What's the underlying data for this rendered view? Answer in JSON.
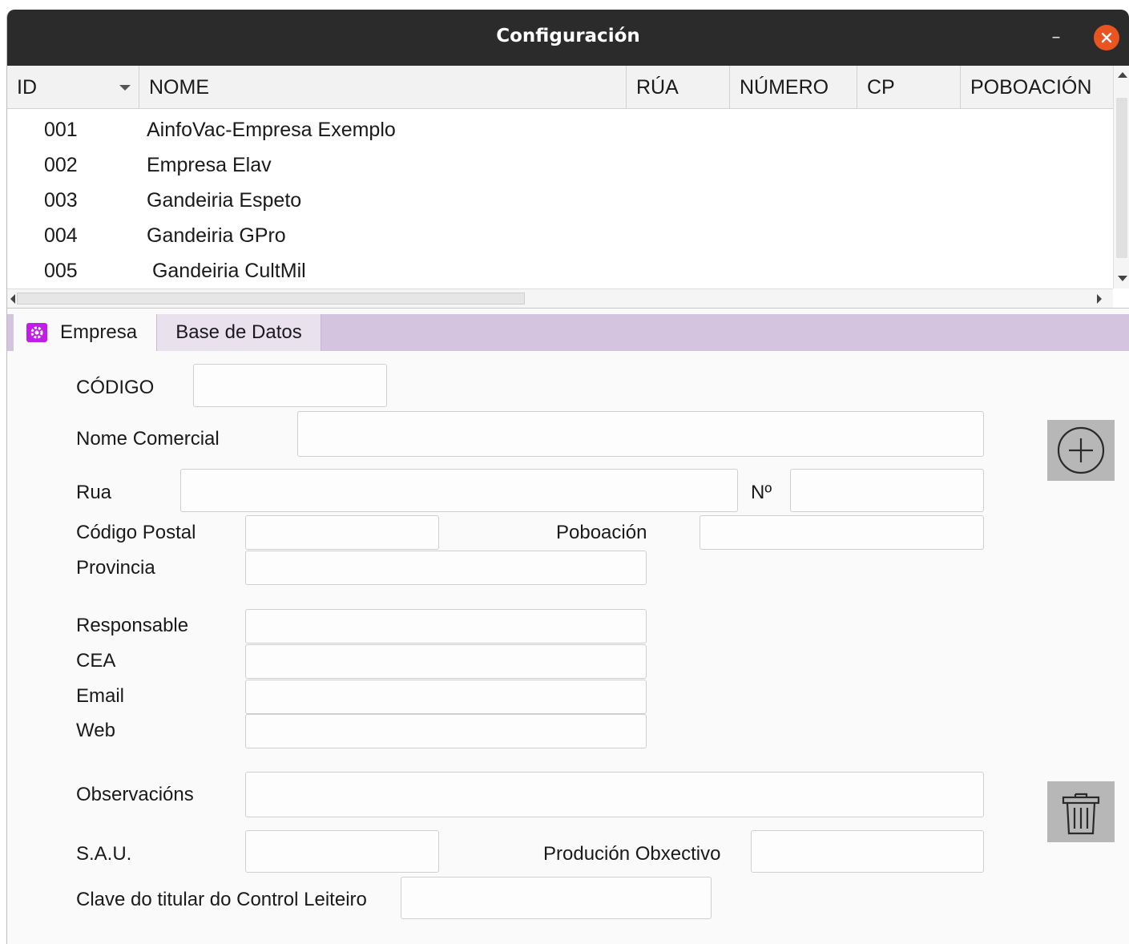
{
  "window": {
    "title": "Configuración",
    "minimize_glyph": "–"
  },
  "table": {
    "columns": [
      "ID",
      "NOME",
      "RÚA",
      "NÚMERO",
      "CP",
      "POBOACIÓN"
    ],
    "rows": [
      {
        "id": "001",
        "nome": "AinfoVac-Empresa Exemplo"
      },
      {
        "id": "002",
        "nome": "Empresa Elav"
      },
      {
        "id": "003",
        "nome": "Gandeiria Espeto"
      },
      {
        "id": "004",
        "nome": "Gandeiria GPro"
      },
      {
        "id": "005",
        "nome": " Gandeiria CultMil"
      }
    ]
  },
  "tabs": {
    "empresa": "Empresa",
    "base_datos": "Base de Datos"
  },
  "form": {
    "codigo": "CÓDIGO",
    "nome_comercial": "Nome Comercial",
    "rua": "Rua",
    "numero": "Nº",
    "codigo_postal": "Código Postal",
    "poboacion": "Poboación",
    "provincia": "Provincia",
    "responsable": "Responsable",
    "cea": "CEA",
    "email": "Email",
    "web": "Web",
    "observacions": "Observacións",
    "sau": "S.A.U.",
    "producion_obxectivo": "Produción Obxectivo",
    "clave_titular": "Clave do titular do Control Leiteiro"
  },
  "colors": {
    "titlebar": "#2b2b2b",
    "close": "#e95420",
    "tabbar": "#d4c4e0",
    "tab_icon": "#c11de6",
    "side_button": "#b7b7b7"
  },
  "icons": {
    "add": "plus-circle-icon",
    "delete": "trash-icon",
    "tab": "settings-gear-icon"
  }
}
